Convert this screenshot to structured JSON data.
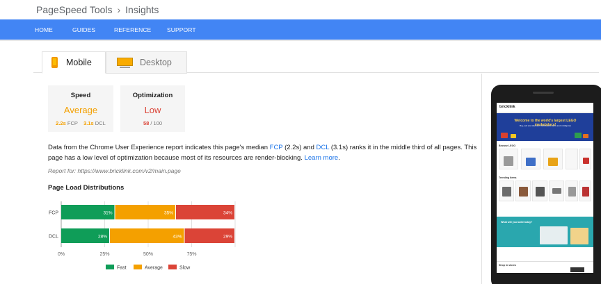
{
  "breadcrumb": {
    "root": "PageSpeed Tools",
    "current": "Insights"
  },
  "nav": {
    "home": "HOME",
    "guides": "GUIDES",
    "reference": "REFERENCE",
    "support": "SUPPORT"
  },
  "tabs": {
    "mobile": "Mobile",
    "desktop": "Desktop"
  },
  "cards": {
    "speed": {
      "title": "Speed",
      "value": "Average",
      "fcp_value": "2.2s",
      "fcp_label": "FCP",
      "dcl_value": "3.1s",
      "dcl_label": "DCL"
    },
    "optimization": {
      "title": "Optimization",
      "value": "Low",
      "score": "58",
      "max": "/ 100"
    }
  },
  "description": {
    "part1": "Data from the Chrome User Experience report indicates this page's median ",
    "fcp_link": "FCP",
    "part2": " (2.2s) and ",
    "dcl_link": "DCL",
    "part3": " (3.1s) ranks it in the middle third of all pages. This page has a low level of optimization because most of its resources are render-blocking. ",
    "learn_more": "Learn more",
    "part4": "."
  },
  "report_for": "Report for: https://www.bricklink.com/v2/main.page",
  "distribution_title": "Page Load Distributions",
  "phone_preview": {
    "logo": "bricklink",
    "hero_title": "Welcome to the world's largest LEGO marketplace!",
    "hero_sub": "Buy, sell and discover LEGO sets, parts and minifigures",
    "section1": "Browse LEGO",
    "section2": "Trending Items",
    "section3": "What will you build today?",
    "section4": "Shop in stores"
  },
  "colors": {
    "fast": "#0f9d58",
    "average": "#f4a000",
    "slow": "#db4437",
    "nav": "#4285f4",
    "link": "#1a73e8"
  },
  "chart_data": {
    "type": "bar",
    "orientation": "horizontal",
    "stacked": true,
    "categories": [
      "FCP",
      "DCL"
    ],
    "series": [
      {
        "name": "Fast",
        "values": [
          31,
          28
        ],
        "color": "#0f9d58"
      },
      {
        "name": "Average",
        "values": [
          35,
          43
        ],
        "color": "#f4a000"
      },
      {
        "name": "Slow",
        "values": [
          34,
          29
        ],
        "color": "#db4437"
      }
    ],
    "xticks": [
      "0%",
      "25%",
      "50%",
      "75%"
    ],
    "xlim": [
      0,
      100
    ],
    "legend": "bottom",
    "grid": true
  }
}
